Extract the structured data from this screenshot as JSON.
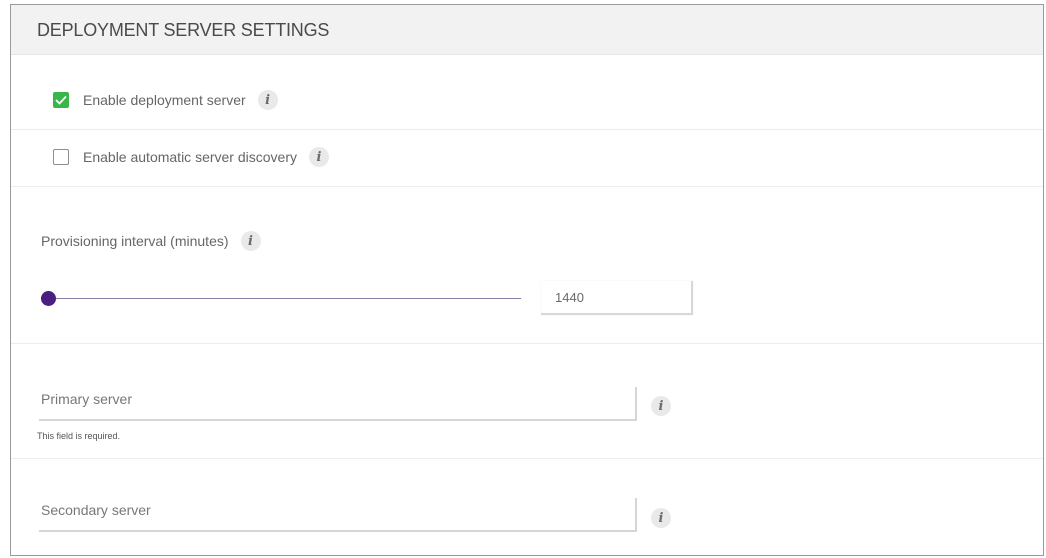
{
  "panel": {
    "title": "DEPLOYMENT SERVER SETTINGS"
  },
  "settings": {
    "enable_deployment_server": {
      "label": "Enable deployment server",
      "checked": true
    },
    "enable_auto_discovery": {
      "label": "Enable automatic server discovery",
      "checked": false
    },
    "provisioning_interval": {
      "label": "Provisioning interval (minutes)",
      "value": "1440",
      "slider_fraction": 0.0
    },
    "primary_server": {
      "placeholder": "Primary server",
      "value": "",
      "helper": "This field is required."
    },
    "secondary_server": {
      "placeholder": "Secondary server",
      "value": ""
    }
  },
  "icons": {
    "info": "i",
    "check": "check-icon"
  },
  "colors": {
    "checkbox_checked": "#39b54a",
    "slider_accent": "#4b1f82",
    "header_bg": "#f2f2f2"
  }
}
